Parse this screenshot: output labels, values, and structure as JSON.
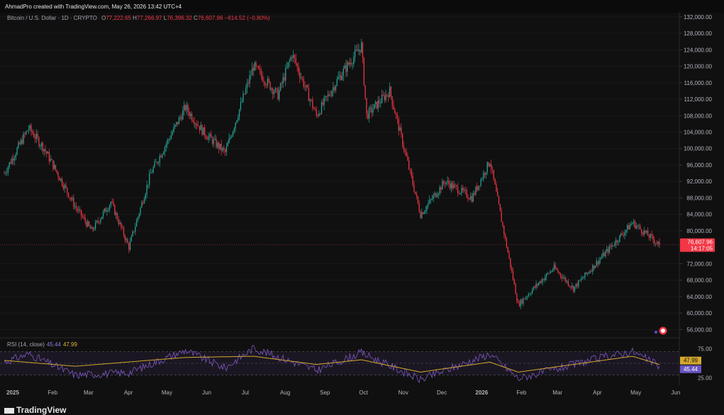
{
  "header": {
    "credit": "AhmadPro created with TradingView.com, May 26, 2026 13:42 UTC+4"
  },
  "legend": {
    "symbol": "Bitcoin / U.S. Dollar · 1D · CRYPTO",
    "o_label": "O",
    "o_value": "77,222.65",
    "h_label": "H",
    "h_value": "77,266.97",
    "l_label": "L",
    "l_value": "76,396.32",
    "c_label": "C",
    "c_value": "76,607.96",
    "change": "−614.52 (−0.80%)"
  },
  "price_scale": {
    "ticks": [
      "132,000.00",
      "128,000.00",
      "124,000.00",
      "120,000.00",
      "116,000.00",
      "112,000.00",
      "108,000.00",
      "104,000.00",
      "100,000.00",
      "96,000.00",
      "92,000.00",
      "88,000.00",
      "84,000.00",
      "80,000.00",
      "72,000.00",
      "68,000.00",
      "64,000.00",
      "60,000.00",
      "56,000.00"
    ],
    "last_price": "76,607.96",
    "countdown": "14:17:05"
  },
  "rsi": {
    "title": "RSI (14, close)",
    "rsi_value": "45.44",
    "ma_value": "47.99",
    "ticks": [
      "75.00",
      "25.00"
    ]
  },
  "time_axis": {
    "labels": [
      "2025",
      "Feb",
      "Mar",
      "Apr",
      "May",
      "Jun",
      "Jul",
      "Aug",
      "Sep",
      "Oct",
      "Nov",
      "Dec",
      "2026",
      "Feb",
      "Mar",
      "Apr",
      "May",
      "Jun"
    ]
  },
  "footer": {
    "logo_text": "TradingView"
  },
  "colors": {
    "up": "#26a69a",
    "down": "#f23645",
    "rsi": "#7e57c2",
    "rsi_ma": "#d4a82e",
    "background": "#101010"
  },
  "chart_data": [
    {
      "type": "line",
      "title": "Bitcoin / U.S. Dollar · 1D · CRYPTO",
      "series": [
        {
          "values": [
            {
              "x": "2025-01-01",
              "y": 94000
            },
            {
              "x": "2025-01-20",
              "y": 105000
            },
            {
              "x": "2025-02-01",
              "y": 100000
            },
            {
              "x": "2025-02-25",
              "y": 86000
            },
            {
              "x": "2025-03-10",
              "y": 80000
            },
            {
              "x": "2025-03-25",
              "y": 87000
            },
            {
              "x": "2025-04-08",
              "y": 76000
            },
            {
              "x": "2025-04-25",
              "y": 94000
            },
            {
              "x": "2025-05-22",
              "y": 110000
            },
            {
              "x": "2025-06-05",
              "y": 104000
            },
            {
              "x": "2025-06-22",
              "y": 99000
            },
            {
              "x": "2025-07-14",
              "y": 120000
            },
            {
              "x": "2025-08-02",
              "y": 113000
            },
            {
              "x": "2025-08-13",
              "y": 123000
            },
            {
              "x": "2025-09-01",
              "y": 108000
            },
            {
              "x": "2025-09-18",
              "y": 117000
            },
            {
              "x": "2025-10-06",
              "y": 125000
            },
            {
              "x": "2025-10-10",
              "y": 108000
            },
            {
              "x": "2025-10-28",
              "y": 114000
            },
            {
              "x": "2025-11-21",
              "y": 84000
            },
            {
              "x": "2025-12-10",
              "y": 92000
            },
            {
              "x": "2025-12-31",
              "y": 88000
            },
            {
              "x": "2026-01-14",
              "y": 97000
            },
            {
              "x": "2026-02-05",
              "y": 62000
            },
            {
              "x": "2026-02-20",
              "y": 67000
            },
            {
              "x": "2026-03-05",
              "y": 71000
            },
            {
              "x": "2026-03-20",
              "y": 66000
            },
            {
              "x": "2026-04-15",
              "y": 75000
            },
            {
              "x": "2026-05-05",
              "y": 82000
            },
            {
              "x": "2026-05-26",
              "y": 76608
            }
          ]
        }
      ],
      "ylim": [
        54000,
        133000
      ]
    },
    {
      "type": "line",
      "title": "RSI (14, close)",
      "series": [
        {
          "values": [
            {
              "x": "2025-01-01",
              "y": 52
            },
            {
              "x": "2025-01-20",
              "y": 66
            },
            {
              "x": "2025-02-25",
              "y": 30
            },
            {
              "x": "2025-04-08",
              "y": 34
            },
            {
              "x": "2025-05-22",
              "y": 72
            },
            {
              "x": "2025-06-22",
              "y": 42
            },
            {
              "x": "2025-07-14",
              "y": 76
            },
            {
              "x": "2025-09-01",
              "y": 38
            },
            {
              "x": "2025-10-06",
              "y": 68
            },
            {
              "x": "2025-11-21",
              "y": 22
            },
            {
              "x": "2026-01-14",
              "y": 66
            },
            {
              "x": "2026-02-05",
              "y": 24
            },
            {
              "x": "2026-04-15",
              "y": 62
            },
            {
              "x": "2026-05-05",
              "y": 70
            },
            {
              "x": "2026-05-26",
              "y": 45.44
            }
          ]
        },
        {
          "values": [
            {
              "x": "2025-01-01",
              "y": 55
            },
            {
              "x": "2025-02-25",
              "y": 45
            },
            {
              "x": "2025-05-22",
              "y": 60
            },
            {
              "x": "2025-07-14",
              "y": 62
            },
            {
              "x": "2025-09-01",
              "y": 48
            },
            {
              "x": "2025-10-06",
              "y": 56
            },
            {
              "x": "2025-11-21",
              "y": 35
            },
            {
              "x": "2026-01-14",
              "y": 52
            },
            {
              "x": "2026-02-05",
              "y": 35
            },
            {
              "x": "2026-05-05",
              "y": 62
            },
            {
              "x": "2026-05-26",
              "y": 47.99
            }
          ]
        }
      ],
      "ylim": [
        15,
        85
      ]
    }
  ]
}
